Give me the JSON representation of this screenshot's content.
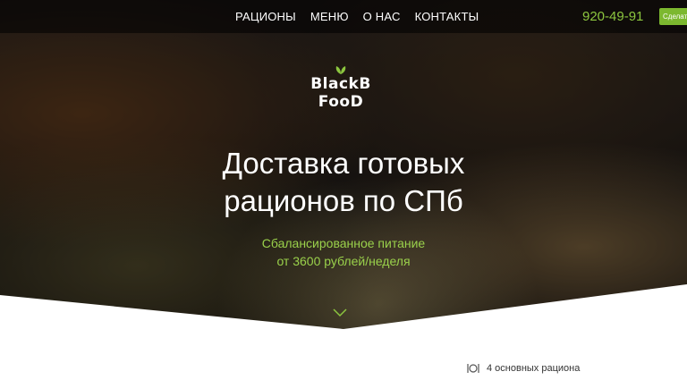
{
  "nav": {
    "items": [
      "РАЦИОНЫ",
      "МЕНЮ",
      "О НАС",
      "КОНТАКТЫ"
    ]
  },
  "header": {
    "phone": "920-49-91",
    "cta_label": "Сделать заказ"
  },
  "logo": {
    "line1": "BlackB",
    "line2": "FooD"
  },
  "hero": {
    "headline_line1": "Доставка готовых",
    "headline_line2": "рационов по СПб",
    "sub_line1": "Сбалансированное питание",
    "sub_line2": "от 3600 рублей/неделя"
  },
  "features": {
    "first": "4 основных рациона"
  },
  "colors": {
    "accent": "#8cc63f",
    "button": "#7cb82f"
  }
}
